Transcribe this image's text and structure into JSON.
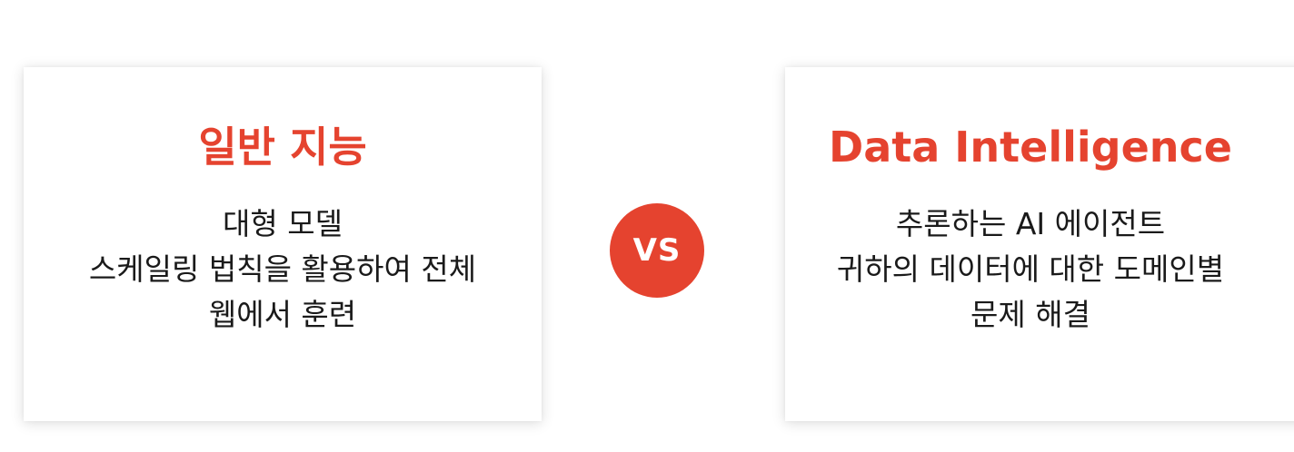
{
  "colors": {
    "accent": "#e5432f",
    "text": "#1a1a1a",
    "background": "#ffffff"
  },
  "left_card": {
    "title": "일반 지능",
    "lines": [
      "대형 모델",
      "스케일링 법칙을 활용하여 전체",
      "웹에서 훈련"
    ]
  },
  "vs": {
    "label": "VS"
  },
  "right_card": {
    "title": "Data Intelligence",
    "lines": [
      "추론하는 AI 에이전트",
      "귀하의 데이터에 대한 도메인별",
      "문제 해결"
    ]
  }
}
